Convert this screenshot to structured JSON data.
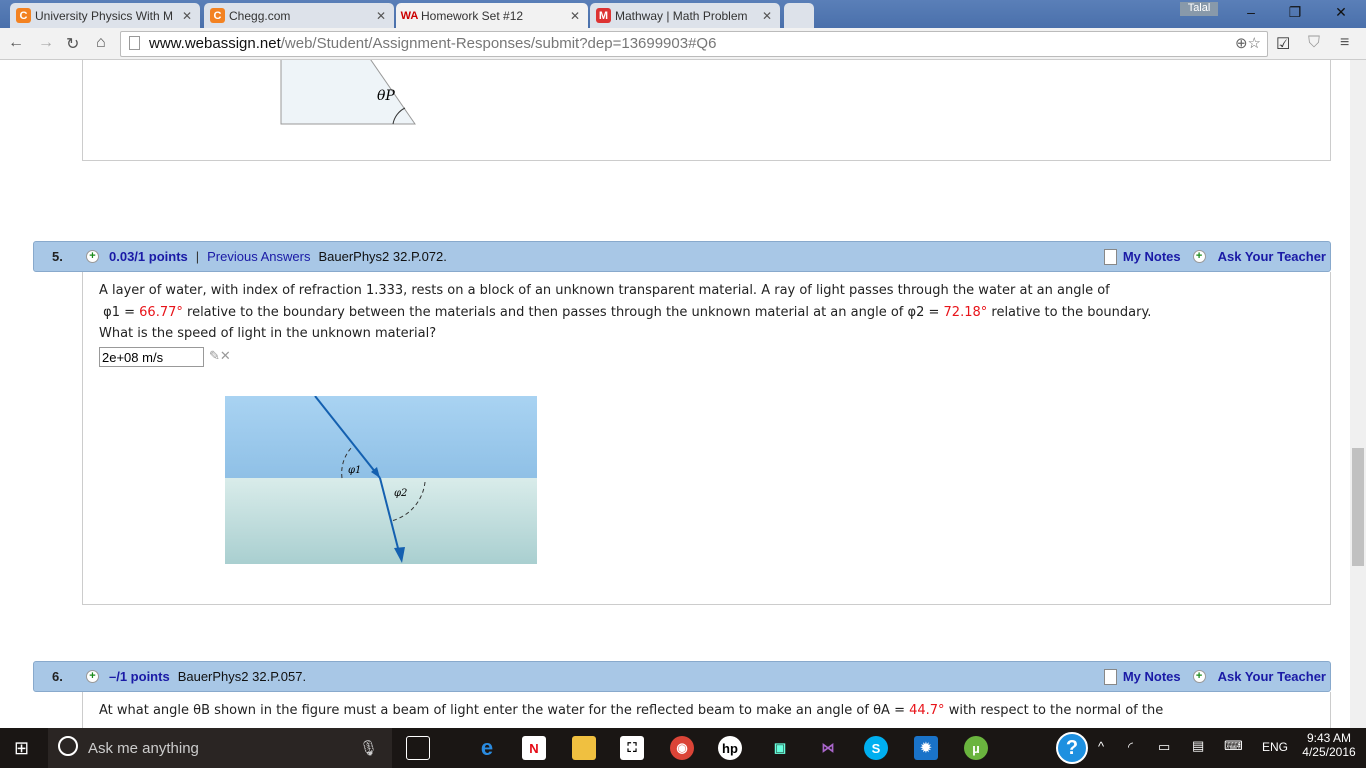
{
  "browser": {
    "tabs": [
      {
        "label": "University Physics With M",
        "icon": "chegg-icon",
        "color": "#f38221"
      },
      {
        "label": "Chegg.com",
        "icon": "chegg-icon",
        "color": "#f38221"
      },
      {
        "label": "Homework Set #12",
        "icon": "webassign-icon",
        "color": "#c00"
      },
      {
        "label": "Mathway | Math Problem",
        "icon": "mathway-icon",
        "color": "#d33"
      }
    ],
    "user": "Talal",
    "url_domain": "www.webassign.net",
    "url_path": "/web/Student/Assignment-Responses/submit?dep=13699903#Q6"
  },
  "q5": {
    "number": "5.",
    "points": "0.03/1 points",
    "separator": "|",
    "previous": "Previous Answers",
    "source": "BauerPhys2 32.P.072.",
    "text1": "A layer of water, with index of refraction 1.333, rests on a block of an unknown transparent material. A ray of light passes through the water at an angle of",
    "phi1": "φ1 = ",
    "phi1_val": "66.77°",
    "text2": " relative to the boundary between the materials and then passes through the unknown material at an angle of ",
    "phi2": "φ2 = ",
    "phi2_val": "72.18°",
    "text3": " relative to the boundary.",
    "text4": "What is the speed of light in the unknown material?",
    "answer": "2e+08 m/s",
    "fig_phi1": "φ1",
    "fig_phi2": "φ2"
  },
  "notes": {
    "my_notes": "My Notes",
    "ask": "Ask Your Teacher"
  },
  "q6": {
    "number": "6.",
    "points": "–/1 points",
    "source": "BauerPhys2 32.P.057.",
    "text1": "At what angle θB shown in the figure must a beam of light enter the water for the reflected beam to make an angle of θA = ",
    "thetaA": "44.7°",
    "text2": " with respect to the normal of the"
  },
  "top_figure_label": "θP",
  "taskbar": {
    "search": "Ask me anything",
    "lang": "ENG",
    "time": "9:43 AM",
    "date": "4/25/2016"
  },
  "colors": {
    "header": "#a8c7e6",
    "link": "#1a1aa6",
    "value": "#e8141a"
  }
}
